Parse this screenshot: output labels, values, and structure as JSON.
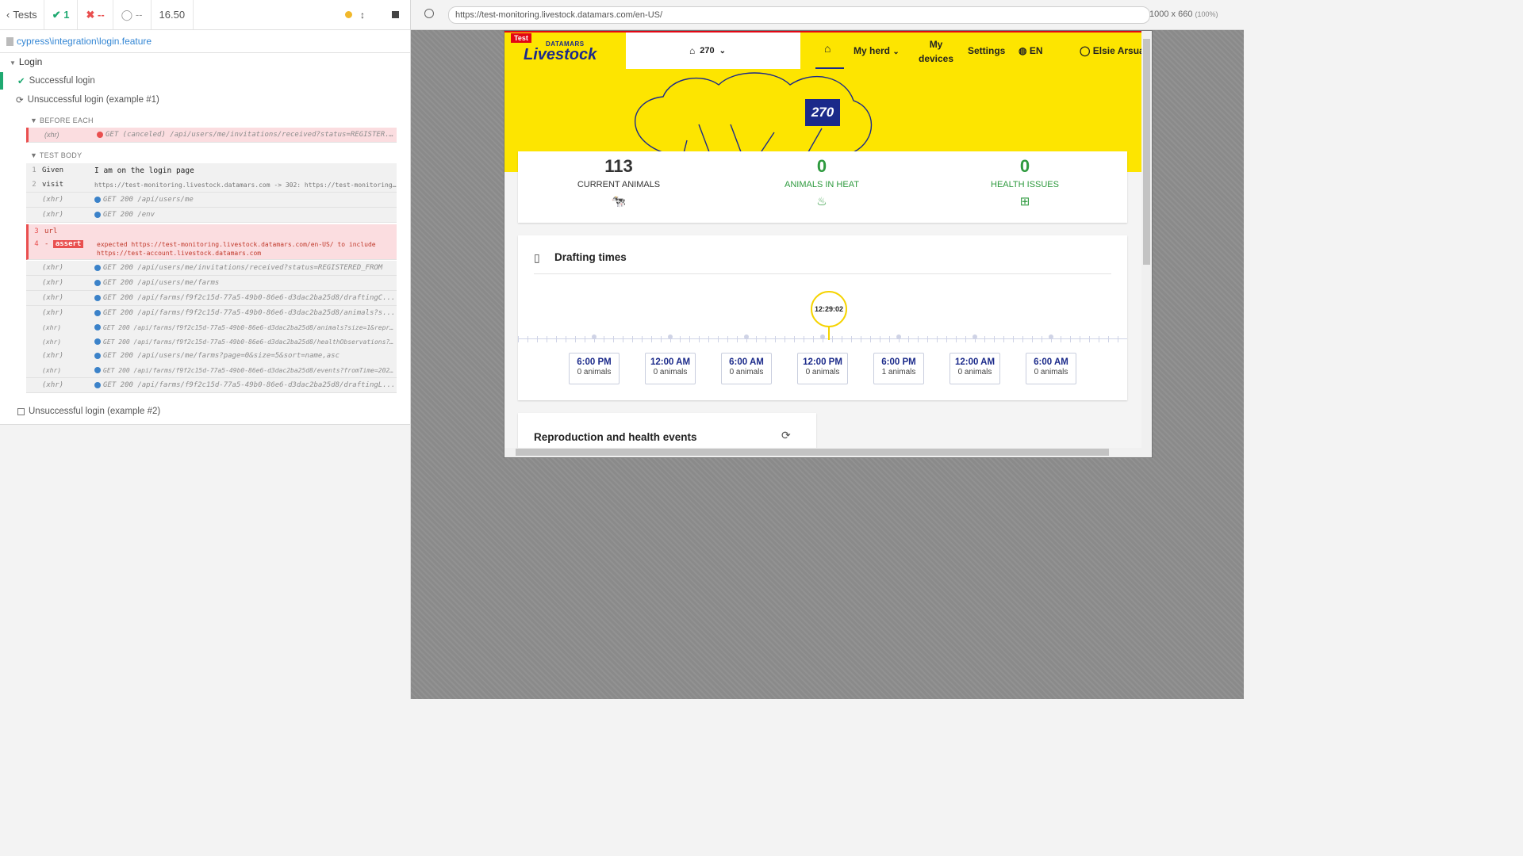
{
  "reporter": {
    "back_label": "Tests",
    "passed": "1",
    "failed": "--",
    "pending": "--",
    "duration": "16.50",
    "spec_path": "cypress\\integration\\login.feature",
    "suite": "Login",
    "tests": [
      {
        "title": "Successful login",
        "state": "passed"
      },
      {
        "title": "Unsuccessful login (example #1)",
        "state": "running"
      },
      {
        "title": "Unsuccessful login (example #2)",
        "state": "pending"
      }
    ],
    "before_each_label": "BEFORE EACH",
    "test_body_label": "TEST BODY",
    "before_each": [
      {
        "name": "(xhr)",
        "msg": "GET (canceled) /api/users/me/invitations/received?status=REGISTER..."
      }
    ],
    "commands": [
      {
        "num": "1",
        "name": "Given",
        "msg": "I am on the login page",
        "type": "step"
      },
      {
        "num": "2",
        "name": "visit",
        "msg": "https://test-monitoring.livestock.datamars.com -> 302: https://test-monitoring.l...",
        "type": "cmd"
      },
      {
        "num": "",
        "name": "(xhr)",
        "msg": "GET 200 /api/users/me",
        "type": "xhr"
      },
      {
        "num": "",
        "name": "(xhr)",
        "msg": "GET 200 /env",
        "type": "xhr"
      },
      {
        "num": "3",
        "name": "url",
        "msg": "",
        "type": "failed"
      },
      {
        "num": "4",
        "name": "assert",
        "msg": "expected https://test-monitoring.livestock.datamars.com/en-US/ to include https://test-account.livestock.datamars.com",
        "type": "failed-assert"
      },
      {
        "num": "",
        "name": "(xhr)",
        "msg": "GET 200 /api/users/me/invitations/received?status=REGISTERED_FROM",
        "type": "xhr"
      },
      {
        "num": "",
        "name": "(xhr)",
        "msg": "GET 200 /api/users/me/farms",
        "type": "xhr"
      },
      {
        "num": "",
        "name": "(xhr)",
        "msg": "GET 200 /api/farms/f9f2c15d-77a5-49b0-86e6-d3dac2ba25d8/draftingC...",
        "type": "xhr"
      },
      {
        "num": "",
        "name": "(xhr)",
        "msg": "GET 200 /api/farms/f9f2c15d-77a5-49b0-86e6-d3dac2ba25d8/animals?s...",
        "type": "xhr"
      },
      {
        "num": "",
        "name": "(xhr)",
        "msg": "GET 200 /api/farms/f9f2c15d-77a5-49b0-86e6-d3dac2ba25d8/animals?size=1&reprodu...",
        "type": "xhr"
      },
      {
        "num": "",
        "name": "(xhr)",
        "msg": "GET 200 /api/farms/f9f2c15d-77a5-49b0-86e6-d3dac2ba25d8/healthObservations?siz...",
        "type": "xhr"
      },
      {
        "num": "",
        "name": "(xhr)",
        "msg": "GET 200 /api/users/me/farms?page=0&size=5&sort=name,asc",
        "type": "xhr"
      },
      {
        "num": "",
        "name": "(xhr)",
        "msg": "GET 200 /api/farms/f9f2c15d-77a5-49b0-86e6-d3dac2ba25d8/events?fromTime=2021-0...",
        "type": "xhr"
      },
      {
        "num": "",
        "name": "(xhr)",
        "msg": "GET 200 /api/farms/f9f2c15d-77a5-49b0-86e6-d3dac2ba25d8/draftingL...",
        "type": "xhr"
      }
    ]
  },
  "aut": {
    "url": "https://test-monitoring.livestock.datamars.com/en-US/",
    "viewport": "1000 x 660",
    "zoom": "(100%)"
  },
  "app": {
    "test_badge": "Test",
    "brand_top": "DATAMARS",
    "brand_main": "Livestock",
    "herd_count": "270",
    "nav": {
      "my_herd": "My herd",
      "my_devices_1": "My",
      "my_devices_2": "devices",
      "settings": "Settings",
      "lang": "EN",
      "user": "Elsie Arsua"
    },
    "herd_badge": "270",
    "stats": [
      {
        "value": "113",
        "label": "CURRENT ANIMALS",
        "color": "#222222",
        "icon": "cow-icon"
      },
      {
        "value": "0",
        "label": "ANIMALS IN HEAT",
        "color": "#2e9a3e",
        "icon": "heat-icon"
      },
      {
        "value": "0",
        "label": "HEALTH ISSUES",
        "color": "#2e9a3e",
        "icon": "medical-kit-icon"
      }
    ],
    "drafting_title": "Drafting times",
    "now_time": "12:29:02",
    "slots": [
      {
        "time": "6:00 PM",
        "animals": "0 animals"
      },
      {
        "time": "12:00 AM",
        "animals": "0 animals"
      },
      {
        "time": "6:00 AM",
        "animals": "0 animals"
      },
      {
        "time": "12:00 PM",
        "animals": "0 animals"
      },
      {
        "time": "6:00 PM",
        "animals": "1 animals"
      },
      {
        "time": "12:00 AM",
        "animals": "0 animals"
      },
      {
        "time": "6:00 AM",
        "animals": "0 animals"
      }
    ],
    "repro_title": "Reproduction and health events"
  },
  "colors": {
    "brand_yellow": "#fde500",
    "brand_blue": "#1b2a8a",
    "pass_green": "#1fa971",
    "fail_red": "#e94f4f"
  }
}
